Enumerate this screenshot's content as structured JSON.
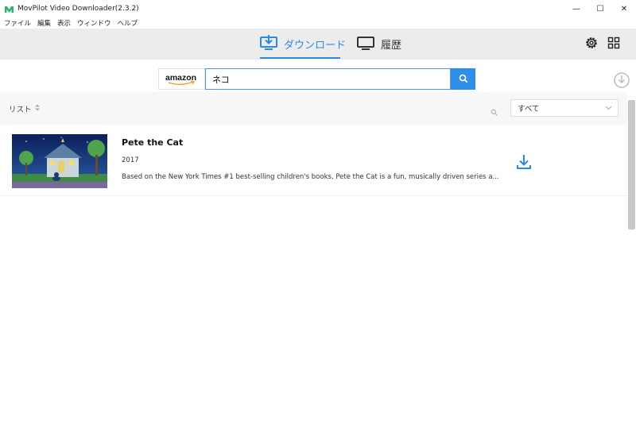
{
  "window": {
    "title": "MovPilot Video Downloader(2.3.2)",
    "controls": [
      "—",
      "☐",
      "✕"
    ]
  },
  "menu": {
    "items": [
      "ファイル",
      "編集",
      "表示",
      "ウィンドウ",
      "ヘルプ"
    ]
  },
  "nav": {
    "tabs": [
      {
        "label": "ダウンロード",
        "icon": "download-monitor-icon",
        "active": true
      },
      {
        "label": "履歴",
        "icon": "monitor-icon",
        "active": false
      }
    ],
    "settings_icon": "gear-icon",
    "layout_icon": "grid-icon"
  },
  "search": {
    "site": "amazon",
    "query": "ネコ",
    "button_icon": "search-icon"
  },
  "list": {
    "label": "リスト",
    "filter_value": "すべて"
  },
  "results": [
    {
      "title": "Pete the Cat",
      "year": "2017",
      "description": "Based on the New York Times #1 best-selling children's books, Pete the Cat is a fun, musically driven series a..."
    }
  ],
  "colors": {
    "accent": "#2a8ae6",
    "nav_background": "#ececec",
    "search_button": "#2e8ee8"
  }
}
